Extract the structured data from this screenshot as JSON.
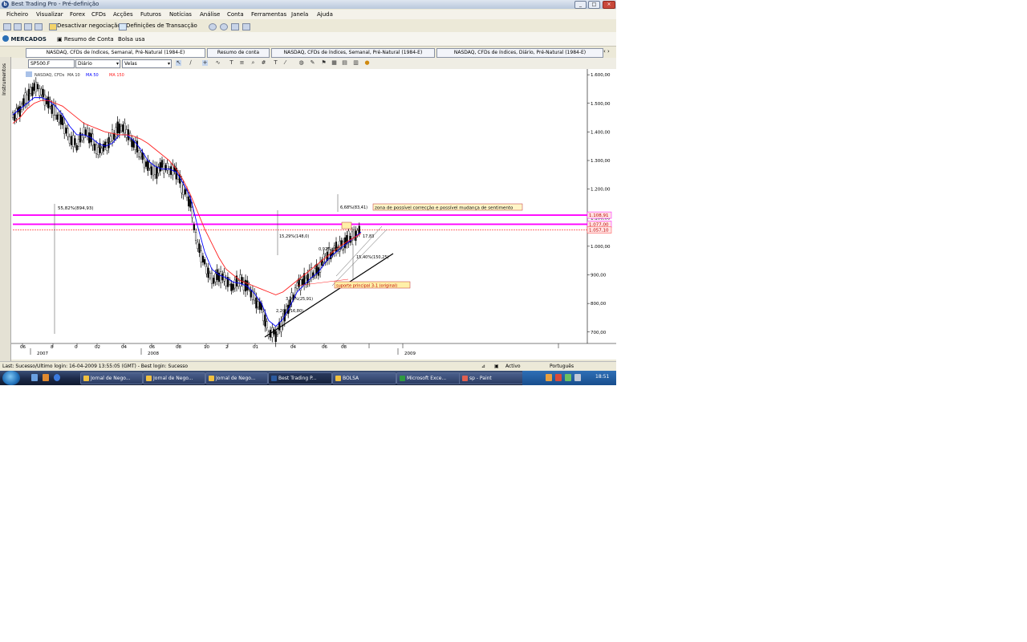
{
  "window": {
    "title": "Best Trading Pro - Pré-definição"
  },
  "menu": [
    "Ficheiro",
    "Visualizar",
    "Forex",
    "CFDs",
    "Acções",
    "Futuros",
    "Notícias",
    "Análise",
    "Conta",
    "Ferramentas",
    "Janela",
    "Ajuda"
  ],
  "toolbar1": {
    "disable_trading": "Desactivar negociação",
    "transaction_settings": "Definições de Transacção"
  },
  "toolbar2": {
    "markets": "MERCADOS",
    "account_summary": "Resumo de Conta",
    "bolsa": "Bolsa usa"
  },
  "tabs": [
    "NASDAQ, CFDs de índices, Semanal, Pré-Natural (1984-E)",
    "Resumo de conta",
    "NASDAQ, CFDs de índices, Semanal, Pré-Natural (1984-E)",
    "NASDAQ, CFDs de índices, Diário, Pré-Natural (1984-E)"
  ],
  "side_tab": "Instrumentos",
  "chart_toolbar": {
    "symbol": "SP500.F",
    "period": "Diário",
    "chart_style": "Velas"
  },
  "indicator_legend": [
    "NASDAQ, CFDs",
    "MA 10",
    "MA 50",
    "MA 150"
  ],
  "chart_data": {
    "type": "candlestick",
    "symbol": "SP500.F",
    "y_axis": {
      "ticks": [
        "1.600,00",
        "1.500,00",
        "1.400,00",
        "1.300,00",
        "1.200,00",
        "1.100,00",
        "1.000,00",
        "900,00",
        "800,00",
        "700,00"
      ],
      "price_labels": [
        "1.108,91",
        "1.077,00",
        "1.057,10"
      ],
      "ylim": [
        660,
        1620
      ]
    },
    "x_axis": {
      "month_ticks": [
        "06",
        "8",
        "0",
        "02",
        "04",
        "06",
        "08",
        "10",
        "2",
        "01",
        "04",
        "06",
        "08"
      ],
      "year_labels": [
        "2007",
        "2008",
        "2009"
      ]
    },
    "series": [
      {
        "name": "Price",
        "color": "#000000",
        "values": [
          1450,
          1480,
          1520,
          1560,
          1540,
          1500,
          1470,
          1430,
          1380,
          1350,
          1400,
          1380,
          1330,
          1350,
          1380,
          1420,
          1400,
          1360,
          1320,
          1280,
          1260,
          1280,
          1270,
          1260,
          1200,
          1150,
          1000,
          940,
          880,
          900,
          880,
          860,
          880,
          860,
          820,
          780,
          700,
          690,
          740,
          800,
          860,
          880,
          900,
          920,
          960,
          980,
          1000,
          1020,
          1040,
          1060
        ]
      },
      {
        "name": "MA 10",
        "color": "#0000ff",
        "values": [
          1460,
          1480,
          1500,
          1520,
          1520,
          1510,
          1490,
          1460,
          1420,
          1390,
          1390,
          1380,
          1360,
          1350,
          1360,
          1390,
          1390,
          1370,
          1340,
          1300,
          1280,
          1270,
          1270,
          1260,
          1220,
          1170,
          1070,
          980,
          920,
          900,
          890,
          875,
          870,
          860,
          835,
          800,
          740,
          720,
          745,
          790,
          840,
          865,
          890,
          910,
          945,
          970,
          990,
          1010,
          1030,
          1050
        ]
      },
      {
        "name": "MA 50",
        "color": "#ff2020",
        "values": [
          1430,
          1450,
          1480,
          1500,
          1510,
          1510,
          1500,
          1490,
          1470,
          1450,
          1430,
          1420,
          1410,
          1400,
          1395,
          1390,
          1390,
          1385,
          1375,
          1360,
          1340,
          1320,
          1300,
          1270,
          1230,
          1180,
          1120,
          1060,
          1010,
          960,
          920,
          900,
          880,
          870,
          860,
          850,
          840,
          830,
          840,
          860,
          880,
          900,
          920,
          940,
          960,
          980,
          1000,
          1015,
          1030,
          1045
        ]
      }
    ],
    "levels": [
      {
        "value": 1108.91,
        "color": "#ff00ff",
        "label": "1.108,91"
      },
      {
        "value": 1077.0,
        "color": "#ff00ff",
        "label": "1.077,00"
      },
      {
        "value": 1057.1,
        "color": "#ff4040",
        "label": "1.057,10"
      }
    ],
    "annotations": [
      "zona de possível correcção e possível mudança de sentimento",
      "55,82%(894,93)",
      "6,68%(83,41)",
      "15,29%(148,0)",
      "0,92%(8,95)",
      "15,40%(150,25)",
      "3,95%(25,91)",
      "2,20%(16,80)",
      "17,83",
      "suporte principal 3-1 (original)"
    ]
  },
  "status_bar": {
    "left": "Last: Sucesso/Ultimo login: 16-04-2009 13:55:05 (GMT) - Best login: Sucesso",
    "mode": "Activo",
    "language": "Português"
  },
  "taskbar": {
    "tasks": [
      "Jornal de Nego...",
      "Jornal de Nego...",
      "Jornal de Nego...",
      "Best Trading P...",
      "BOLSA",
      "Microsoft Exce...",
      "sp - Paint"
    ],
    "clock": "18:51"
  }
}
